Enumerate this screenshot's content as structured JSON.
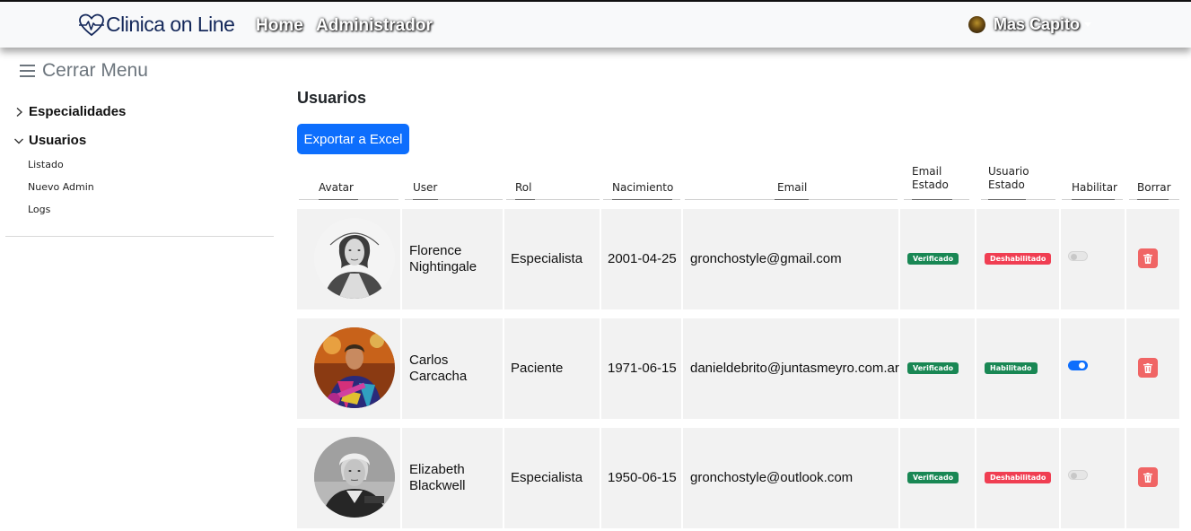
{
  "navbar": {
    "brand": "Clinica on Line",
    "links": [
      "Home",
      "Administrador"
    ],
    "user_name": "Mas Capito"
  },
  "sidebar": {
    "toggle_label": "Cerrar Menu",
    "sections": [
      {
        "label": "Especialidades",
        "expanded": false
      },
      {
        "label": "Usuarios",
        "expanded": true,
        "items": [
          "Listado",
          "Nuevo Admin",
          "Logs"
        ]
      }
    ]
  },
  "main": {
    "title": "Usuarios",
    "export_label": "Exportar a Excel"
  },
  "table": {
    "columns": [
      "Avatar",
      "User",
      "Rol",
      "Nacimiento",
      "Email",
      "Email Estado",
      "Usuario Estado",
      "Habilitar",
      "Borrar"
    ],
    "rows": [
      {
        "first": "Florence",
        "last": "Nightingale",
        "role": "Especialista",
        "birth": "2001-04-25",
        "email": "gronchostyle@gmail.com",
        "email_state": "Verificado",
        "user_state": "Deshabilitado",
        "enabled": false
      },
      {
        "first": "Carlos",
        "last": "Carcacha",
        "role": "Paciente",
        "birth": "1971-06-15",
        "email": "danieldebrito@juntasmeyro.com.ar",
        "email_state": "Verificado",
        "user_state": "Habilitado",
        "enabled": true
      },
      {
        "first": "Elizabeth",
        "last": "Blackwell",
        "role": "Especialista",
        "birth": "1950-06-15",
        "email": "gronchostyle@outlook.com",
        "email_state": "Verificado",
        "user_state": "Deshabilitado",
        "enabled": false
      }
    ]
  },
  "colors": {
    "primary": "#0d6efd",
    "success": "#198754",
    "danger": "#f03e52",
    "delete": "#f06565",
    "brand": "#14285a"
  },
  "icons": {
    "brand": "heart-pulse-icon",
    "menu": "hamburger-icon",
    "collapsed": "chevron-right-icon",
    "expanded": "chevron-down-icon",
    "delete": "trash-icon",
    "user_menu": "caret-down-icon"
  }
}
